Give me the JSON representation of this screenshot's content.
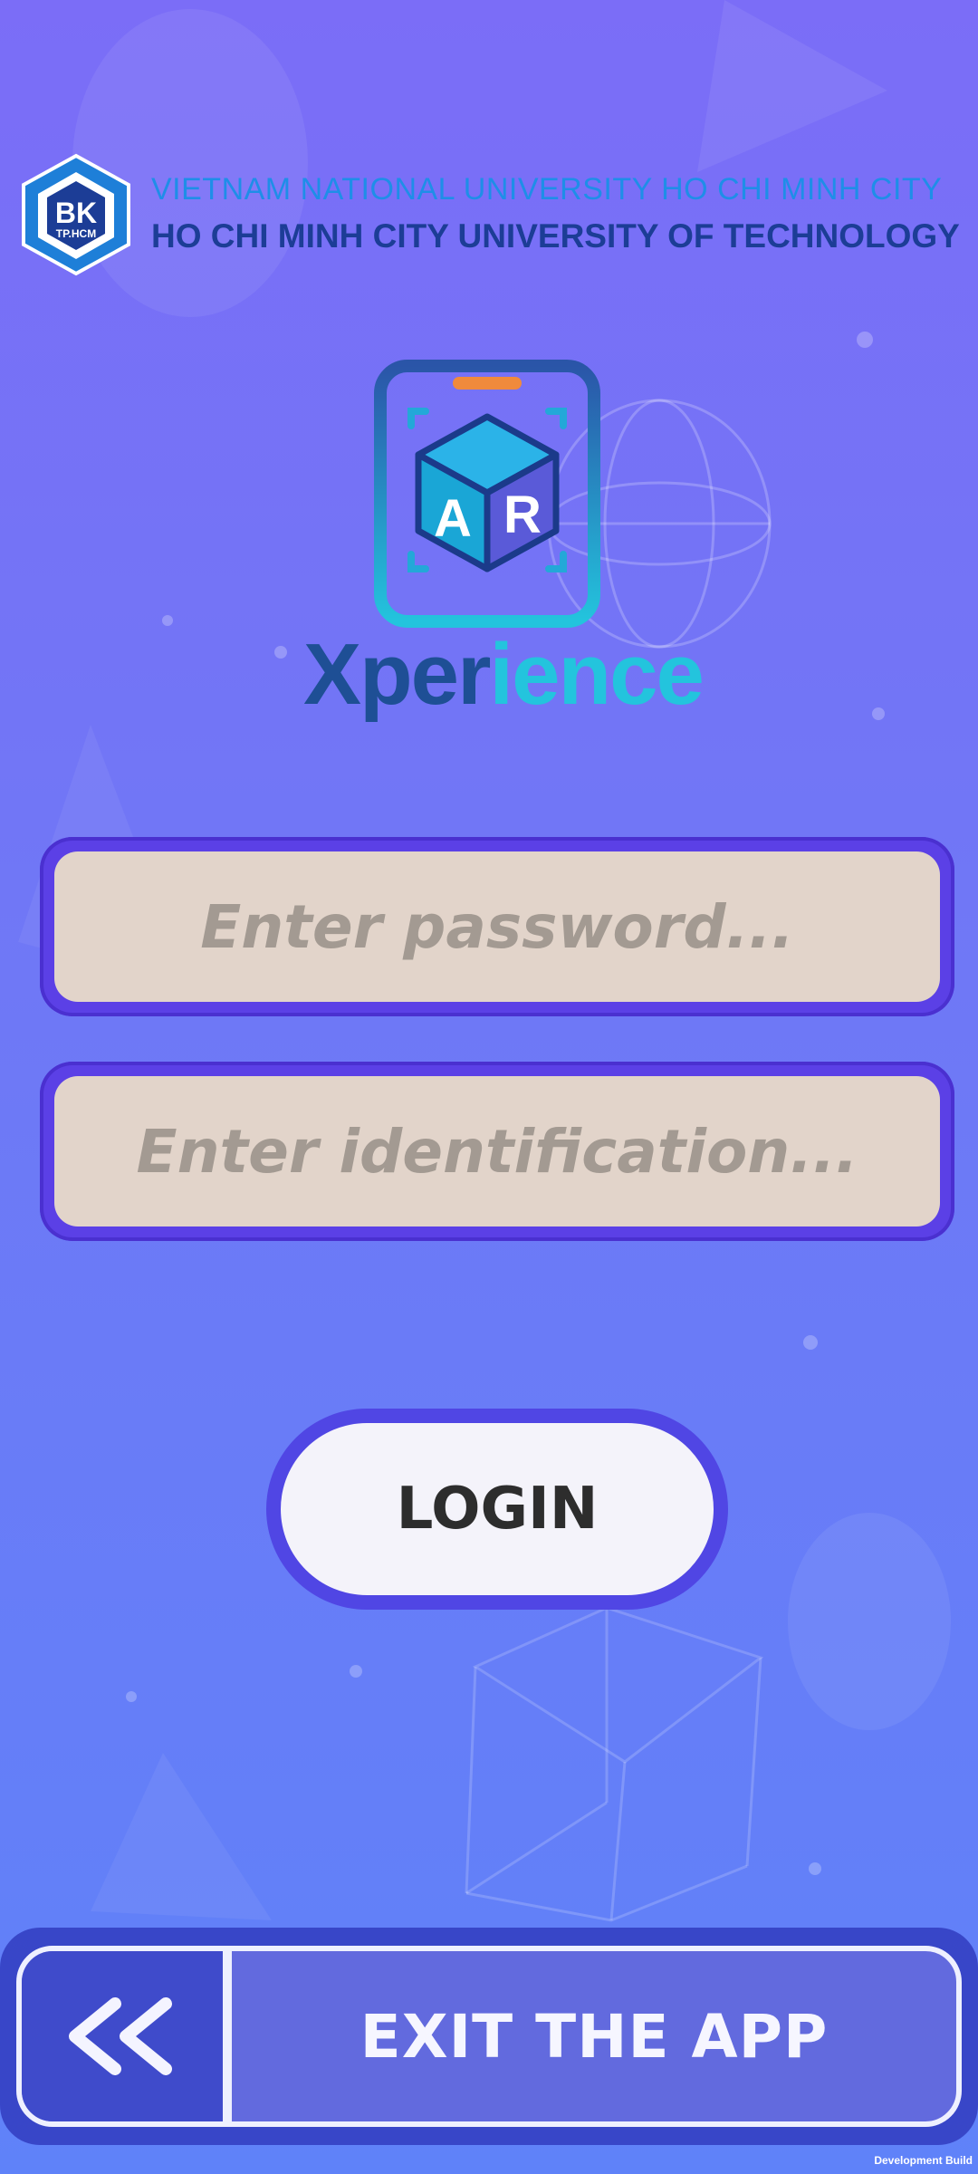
{
  "header": {
    "logo": {
      "line1": "BK",
      "line2": "TP.HCM"
    },
    "university_line1": "VIETNAM NATIONAL UNIVERSITY HO CHI MINH CITY",
    "university_line2": "HO CHI MINH CITY UNIVERSITY OF TECHNOLOGY"
  },
  "app_logo": {
    "icon_letters": [
      "A",
      "R"
    ],
    "brand_part1": "Xper",
    "brand_part2": "ience"
  },
  "form": {
    "password": {
      "value": "",
      "placeholder": "Enter password..."
    },
    "identification": {
      "value": "",
      "placeholder": "Enter identification..."
    },
    "login_label": "LOGIN"
  },
  "footer": {
    "back_icon": "double-chevron-left-icon",
    "exit_label": "EXIT THE APP"
  },
  "dev_build_label": "Development Build",
  "colors": {
    "background_top": "#7b6df7",
    "background_bottom": "#5f82f9",
    "field_fill": "#e2d4ca",
    "field_frame": "#5b40e6",
    "brand_dark": "#1e4f95",
    "brand_light": "#23c4dd",
    "uni_line1": "#1e8ee8",
    "uni_line2": "#1c3d96",
    "exit_bar": "#3846c8"
  }
}
